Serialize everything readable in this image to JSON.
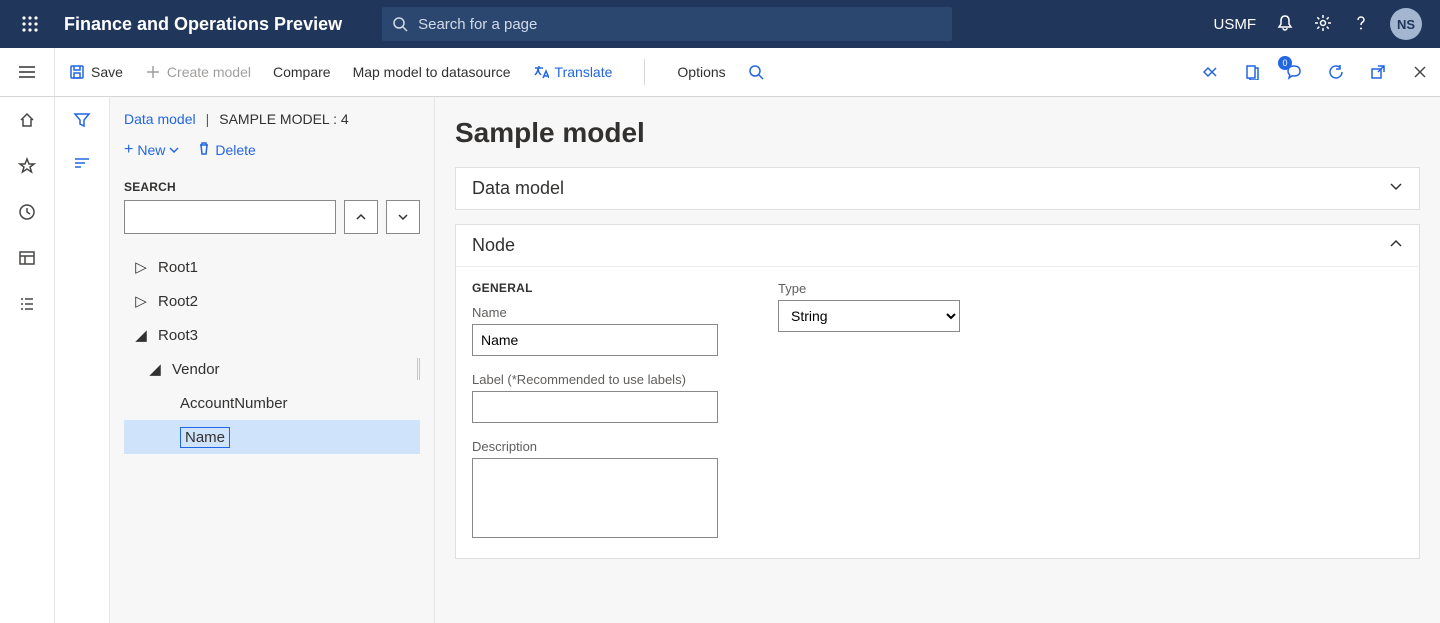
{
  "topbar": {
    "title": "Finance and Operations Preview",
    "search_placeholder": "Search for a page",
    "company": "USMF",
    "avatar_initials": "NS"
  },
  "actionbar": {
    "save": "Save",
    "create_model": "Create model",
    "compare": "Compare",
    "map_model": "Map model to datasource",
    "translate": "Translate",
    "options": "Options",
    "badge_count": "0"
  },
  "breadcrumbs": {
    "link": "Data model",
    "current": "SAMPLE MODEL : 4"
  },
  "tree_toolbar": {
    "new": "New",
    "delete": "Delete"
  },
  "search_label": "SEARCH",
  "tree": {
    "root1": "Root1",
    "root2": "Root2",
    "root3": "Root3",
    "vendor": "Vendor",
    "account_number": "AccountNumber",
    "name": "Name"
  },
  "page_title": "Sample model",
  "card_data_model_title": "Data model",
  "card_node_title": "Node",
  "node_form": {
    "general_caption": "GENERAL",
    "name_label": "Name",
    "name_value": "Name",
    "label_label": "Label (*Recommended to use labels)",
    "label_value": "",
    "description_label": "Description",
    "description_value": "",
    "type_label": "Type",
    "type_value": "String"
  }
}
